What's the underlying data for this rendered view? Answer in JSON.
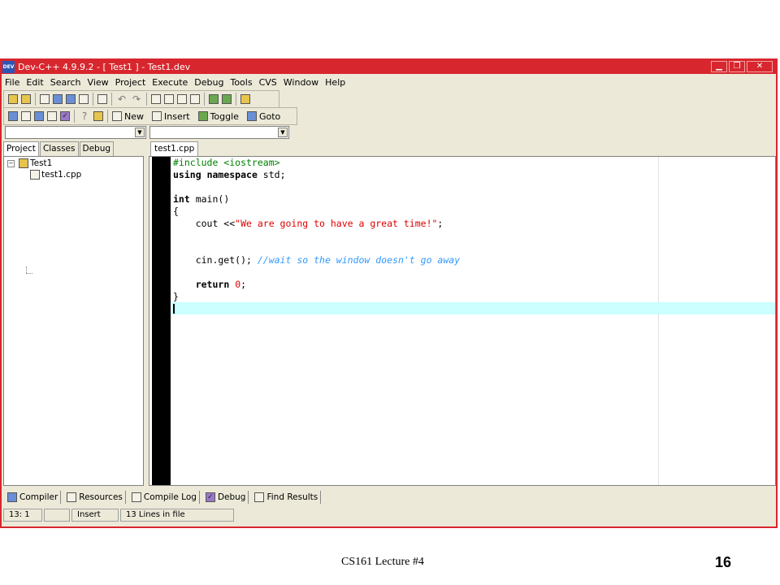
{
  "window": {
    "title": "Dev-C++ 4.9.9.2  -  [ Test1 ] - Test1.dev",
    "app_icon_text": "DEV",
    "accent_color": "#d8262e"
  },
  "menu": [
    "File",
    "Edit",
    "Search",
    "View",
    "Project",
    "Execute",
    "Debug",
    "Tools",
    "CVS",
    "Window",
    "Help"
  ],
  "toolbar": {
    "new_label": "New",
    "insert_label": "Insert",
    "toggle_label": "Toggle",
    "goto_label": "Goto"
  },
  "left_tabs": [
    "Project",
    "Classes",
    "Debug"
  ],
  "project_tree": {
    "root": "Test1",
    "children": [
      "test1.cpp"
    ]
  },
  "editor": {
    "tab_label": "test1.cpp",
    "code_lines": [
      "#include <iostream>",
      "using namespace std;",
      "",
      "int main()",
      "{",
      "    cout <<\"We are going to have a great time!\";",
      "",
      "",
      "    cin.get(); //wait so the window doesn't go away",
      "",
      "    return 0;",
      "}",
      ""
    ]
  },
  "bottom_tabs": [
    "Compiler",
    "Resources",
    "Compile Log",
    "Debug",
    "Find Results"
  ],
  "status": {
    "position": "13: 1",
    "mode": "Insert",
    "info": "13 Lines in file"
  },
  "slide": {
    "footer": "CS161 Lecture #4",
    "page_number": "16"
  }
}
